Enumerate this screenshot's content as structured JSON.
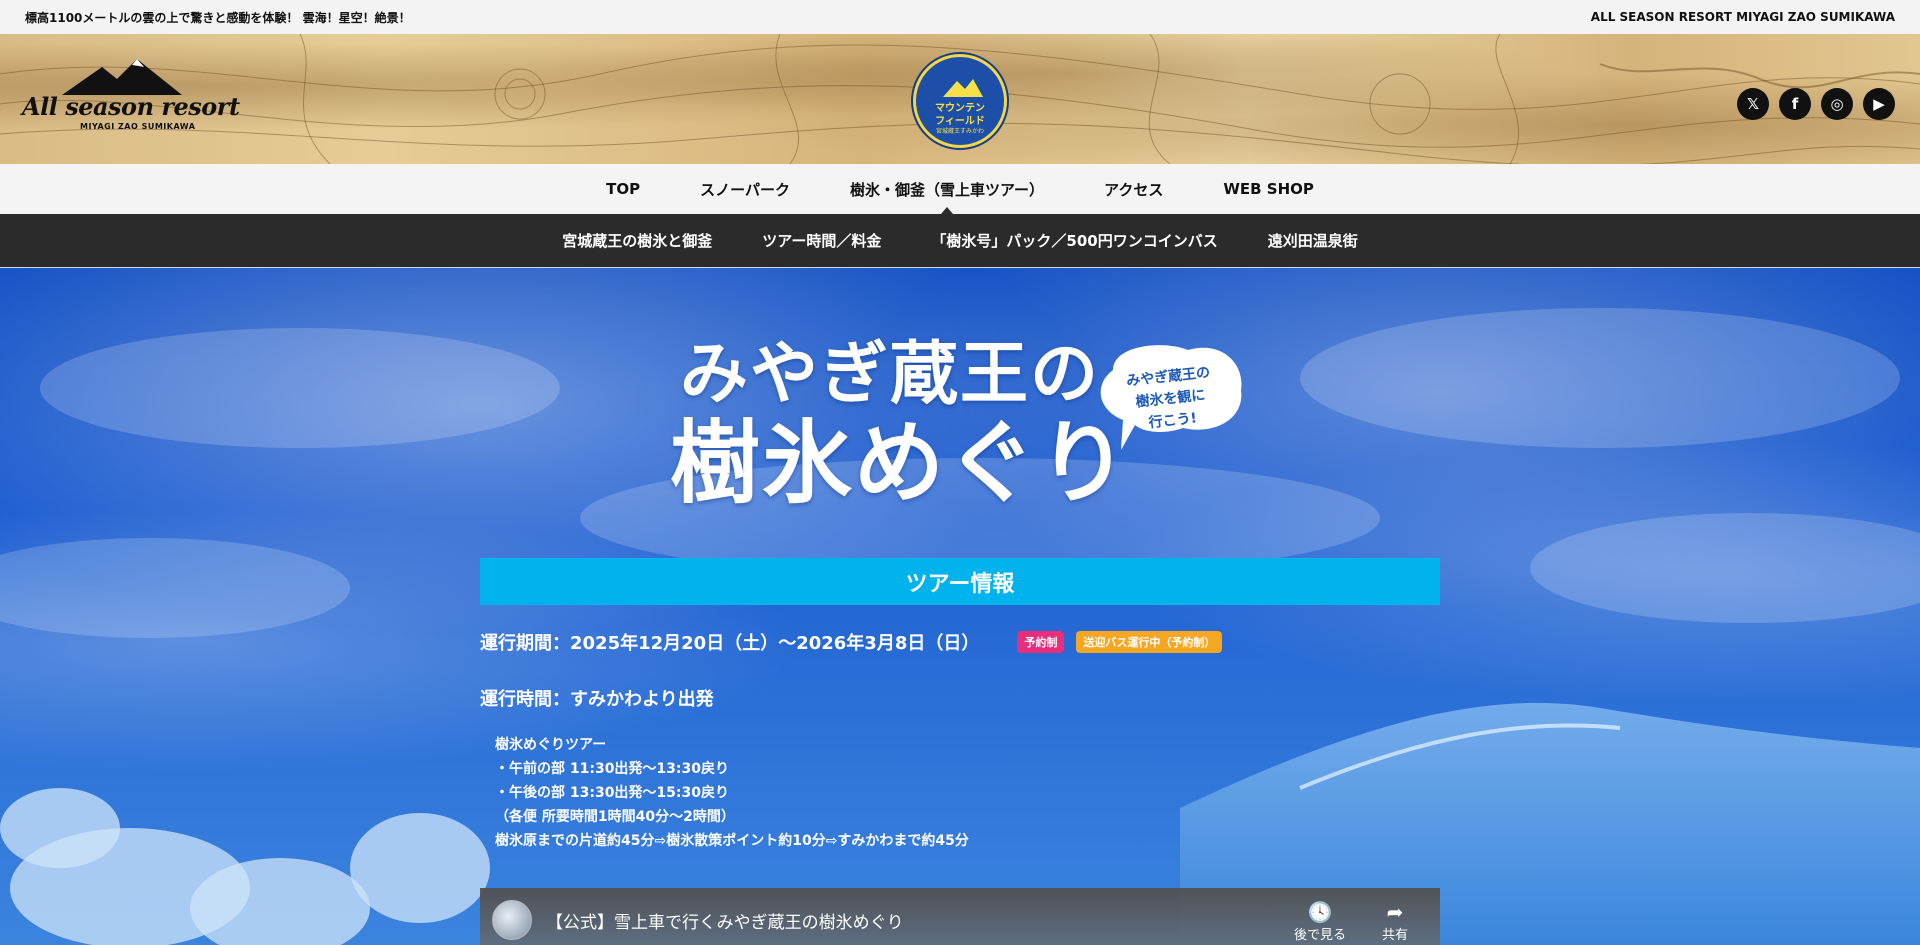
{
  "topbar": {
    "tagline": "標高1100メートルの雲の上で驚きと感動を体験！ 雲海！星空！絶景！",
    "brand": "ALL SEASON RESORT MIYAGI ZAO SUMIKAWA"
  },
  "header": {
    "logo_text": "All season resort",
    "logo_sub": "MIYAGI ZAO SUMIKAWA",
    "badge_line1": "マウンテン",
    "badge_line2": "フィールド",
    "badge_line3": "宮城蔵王すみかわ",
    "social": [
      {
        "name": "x",
        "glyph": "𝕏"
      },
      {
        "name": "facebook",
        "glyph": "f"
      },
      {
        "name": "instagram",
        "glyph": "◎"
      },
      {
        "name": "youtube",
        "glyph": "▶"
      }
    ]
  },
  "main_nav": {
    "items": [
      {
        "label": "TOP"
      },
      {
        "label": "スノーパーク"
      },
      {
        "label": "樹氷・御釜（雪上車ツアー）"
      },
      {
        "label": "アクセス"
      },
      {
        "label": "WEB SHOP"
      }
    ],
    "active_index": 2
  },
  "sub_nav": {
    "items": [
      {
        "label": "宮城蔵王の樹氷と御釜"
      },
      {
        "label": "ツアー時間／料金"
      },
      {
        "label": "「樹氷号」パック／500円ワンコインバス"
      },
      {
        "label": "遠刈田温泉街"
      }
    ]
  },
  "hero": {
    "title_line1": "みやぎ蔵王の",
    "title_line2": "樹氷めぐり",
    "bubble_text": "みやぎ蔵王の樹氷を観に行こう!",
    "bubble_lines": [
      "みやぎ蔵王の",
      "樹氷を観に",
      "行こう!"
    ]
  },
  "tour_info": {
    "heading": "ツアー情報",
    "period": "運行期間：2025年12月20日（土）～2026年3月8日（日）",
    "tag_reservation": "予約制",
    "tag_shuttle": "送迎バス運行中（予約制）",
    "hours": "運行時間：すみかわより出発",
    "details": [
      "樹氷めぐりツアー",
      "・午前の部 11:30出発～13:30戻り",
      "・午後の部 13:30出発～15:30戻り",
      "（各便 所要時間1時間40分～2時間）",
      "樹氷原までの片道約45分⇨樹氷散策ポイント約10分⇨すみかわまで約45分"
    ]
  },
  "video": {
    "title": "【公式】雪上車で行くみやぎ蔵王の樹氷めぐり",
    "watch_later": "後で見る",
    "share": "共有"
  },
  "colors": {
    "info_head": "#00b3ec",
    "tag_pink": "#ea2e7e",
    "tag_yellow": "#f5a623",
    "subnav_bg": "#2b2b2b"
  }
}
